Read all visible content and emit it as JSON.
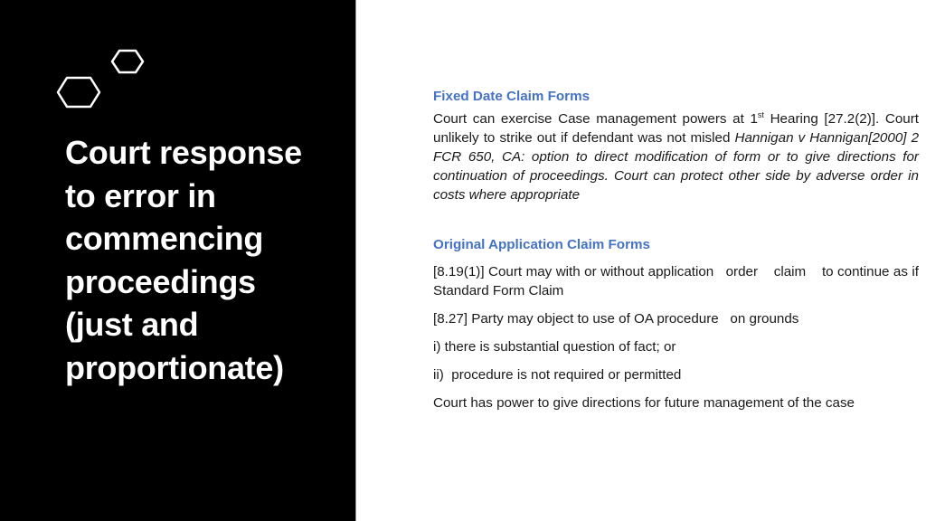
{
  "slide": {
    "title_lines": [
      "Court response",
      "to error in",
      "commencing",
      "proceedings",
      "(just and",
      "proportionate)"
    ],
    "decoration": {
      "icon": "hexagons-icon",
      "stroke_color": "#ffffff"
    },
    "colors": {
      "left_panel": "#000000",
      "heading": "#4472c4",
      "body_text": "#1a1a1a",
      "background": "#ffffff"
    }
  },
  "sections": [
    {
      "heading": "Fixed Date Claim Forms",
      "paragraph": {
        "text_a": "Court can exercise Case management powers at 1",
        "superscript": "st",
        "text_b": " Hearing [27.2(2)]. Court unlikely to strike out if defendant was not misled ",
        "italic": "Hannigan v Hannigan[2000] 2 FCR 650, CA: option to direct modification of form or to give directions for continuation of proceedings. Court can protect other side by adverse order in costs where appropriate"
      }
    },
    {
      "heading": "Original Application Claim Forms",
      "paragraphs": [
        "[8.19(1)] Court may with or without application   order    claim    to continue as if Standard Form Claim",
        "[8.27] Party may object to use of OA procedure   on grounds",
        "i) there is substantial question of fact; or",
        "ii)  procedure is not required or permitted",
        "Court has power to give directions for future management of the case"
      ]
    }
  ]
}
